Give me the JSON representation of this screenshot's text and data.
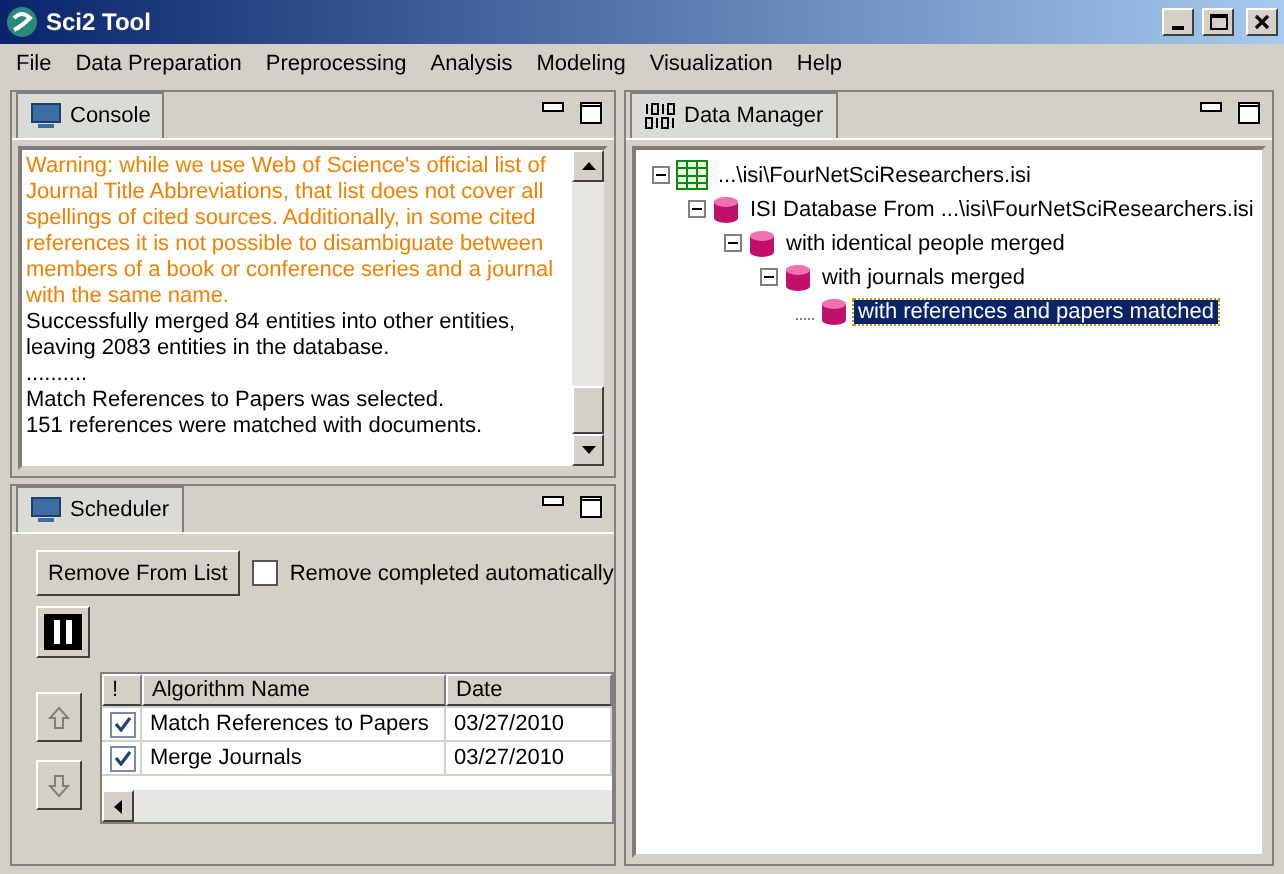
{
  "window": {
    "title": "Sci2 Tool"
  },
  "menu": [
    "File",
    "Data Preparation",
    "Preprocessing",
    "Analysis",
    "Modeling",
    "Visualization",
    "Help"
  ],
  "console": {
    "tab": "Console",
    "messages": [
      {
        "kind": "warning",
        "text": "Warning: while we use Web of Science's official list of Journal Title Abbreviations, that list does not cover all spellings of cited sources. Additionally, in some cited references it is not possible to disambiguate between members of a book or conference series and a journal with the same name."
      },
      {
        "kind": "info",
        "text": "Successfully merged 84 entities into other entities, leaving 2083 entities in the database."
      },
      {
        "kind": "info",
        "text": ".........."
      },
      {
        "kind": "info",
        "text": "Match References to Papers was selected."
      },
      {
        "kind": "info",
        "text": "151 references were matched with documents."
      }
    ]
  },
  "scheduler": {
    "tab": "Scheduler",
    "remove_button": "Remove From List",
    "remove_completed": {
      "label": "Remove completed automatically",
      "checked": false
    },
    "columns": [
      "!",
      "Algorithm Name",
      "Date"
    ],
    "rows": [
      {
        "checked": true,
        "name": "Match References to Papers",
        "date": "03/27/2010"
      },
      {
        "checked": true,
        "name": "Merge Journals",
        "date": "03/27/2010"
      }
    ]
  },
  "data_manager": {
    "tab": "Data Manager",
    "tree": [
      {
        "kind": "table",
        "label": "...\\isi\\FourNetSciResearchers.isi",
        "expanded": true,
        "selected": false,
        "children": [
          {
            "kind": "database",
            "label": "ISI Database From ...\\isi\\FourNetSciResearchers.isi",
            "expanded": true,
            "selected": false,
            "children": [
              {
                "kind": "database",
                "label": "with identical people merged",
                "expanded": true,
                "selected": false,
                "children": [
                  {
                    "kind": "database",
                    "label": "with journals merged",
                    "expanded": true,
                    "selected": false,
                    "children": [
                      {
                        "kind": "database",
                        "label": "with references and papers matched",
                        "expanded": false,
                        "selected": true
                      }
                    ]
                  }
                ]
              }
            ]
          }
        ]
      }
    ]
  }
}
